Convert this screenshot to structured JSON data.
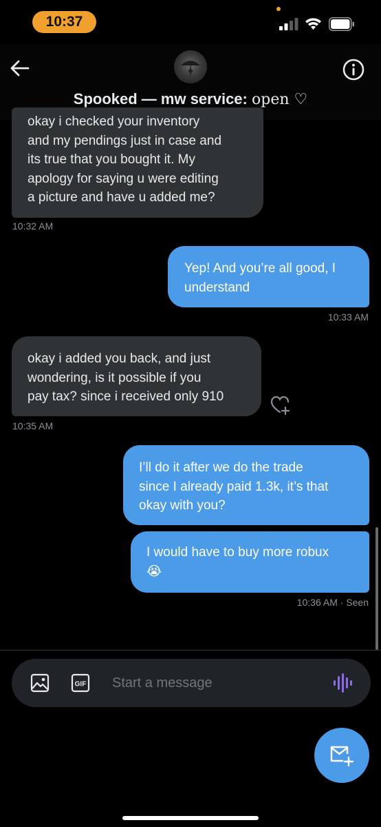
{
  "status_bar": {
    "time": "10:37"
  },
  "header": {
    "title_main": "Spooked — mw service: ",
    "title_open": "open ♡",
    "icons": {
      "back": "back-arrow-icon",
      "info": "info-icon"
    }
  },
  "messages": [
    {
      "direction": "received",
      "lines": [
        "okay i checked your inventory",
        "and my pendings just in case and",
        "its true that you bought it. My",
        "apology for saying u were editing",
        "a picture and have u added me?"
      ],
      "timestamp": "10:32 AM"
    },
    {
      "direction": "sent",
      "lines": [
        "Yep! And you’re all good, I",
        "understand"
      ],
      "timestamp": "10:33 AM"
    },
    {
      "direction": "received",
      "lines": [
        "okay i added you back, and just",
        "wondering, is it possible if you",
        "pay tax? since i received only 910"
      ],
      "timestamp": "10:35 AM"
    },
    {
      "direction": "sent",
      "lines": [
        "I’ll do it after we do the trade",
        "since I already paid 1.3k, it’s that",
        "okay with you?"
      ]
    },
    {
      "direction": "sent",
      "lines": [
        "I would have to buy more robux",
        "😭"
      ],
      "timestamp": "10:36 AM · Seen"
    }
  ],
  "composer": {
    "placeholder": "Start a message",
    "icons": [
      "image-icon",
      "gif-icon",
      "voice-icon"
    ],
    "gif_label": "GIF"
  },
  "colors": {
    "background": "#000000",
    "received_bubble": "#2f3336",
    "sent_bubble": "#4c9be8",
    "accent": "#1d9bf0",
    "time_pill": "#f0a02c"
  }
}
